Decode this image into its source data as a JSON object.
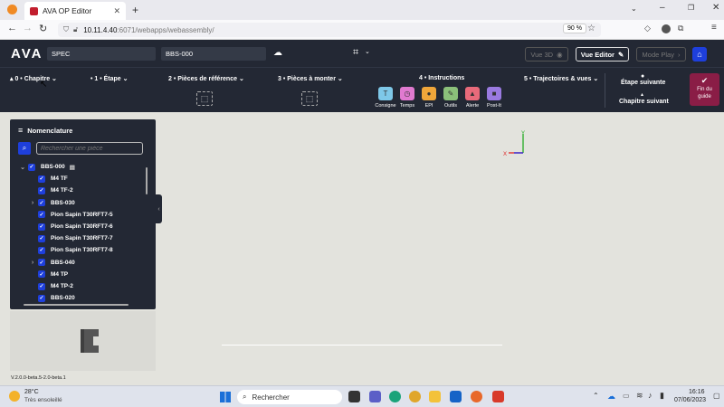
{
  "browser": {
    "tab_title": "AVA OP Editor",
    "url_host": "10.11.4.40",
    "url_rest": ":6071/webapps/webassembly/",
    "zoom": "90 %"
  },
  "header": {
    "logo": "AVA",
    "spec_value": "SPEC",
    "doc_value": "BBS-000",
    "vue3d_label": "Vue 3D",
    "vue_editor_label": "Vue Editor",
    "mode_play_label": "Mode Play"
  },
  "steps": {
    "chapitre": "0 • Chapitre",
    "etape": "1 • Étape",
    "pieces_ref": "2 • Pièces de référence",
    "pieces_monter": "3 • Pièces à monter",
    "instructions": "4 • Instructions",
    "trajectoires": "5 • Trajectoires & vues",
    "etape_suivante": "Étape suivante",
    "chapitre_suivant": "Chapitre suivant",
    "fin_guide": "Fin du guide"
  },
  "instruction_tools": [
    {
      "label": "Consigne",
      "glyph": "T",
      "color": "#7ec8e8"
    },
    {
      "label": "Temps",
      "glyph": "◷",
      "color": "#e07ad0"
    },
    {
      "label": "EPI",
      "glyph": "●",
      "color": "#f0a63a"
    },
    {
      "label": "Outils",
      "glyph": "✎",
      "color": "#8bc07a"
    },
    {
      "label": "Alerte",
      "glyph": "▲",
      "color": "#e86a7a"
    },
    {
      "label": "Post-It",
      "glyph": "■",
      "color": "#9a7ae0"
    }
  ],
  "nomenclature": {
    "title": "Nomenclature",
    "search_placeholder": "Rechercher une pièce",
    "items": [
      {
        "label": "BBS-000",
        "level": 0,
        "expand": "open"
      },
      {
        "label": "M4 TF",
        "level": 1,
        "expand": ""
      },
      {
        "label": "M4 TF-2",
        "level": 1,
        "expand": ""
      },
      {
        "label": "BBS-030",
        "level": 1,
        "expand": "closed"
      },
      {
        "label": "Pion Sapin T30RFT7-5",
        "level": 1,
        "expand": ""
      },
      {
        "label": "Pion Sapin T30RFT7-6",
        "level": 1,
        "expand": ""
      },
      {
        "label": "Pion Sapin T30RFT7-7",
        "level": 1,
        "expand": ""
      },
      {
        "label": "Pion Sapin T30RFT7-8",
        "level": 1,
        "expand": ""
      },
      {
        "label": "BBS-040",
        "level": 1,
        "expand": "closed"
      },
      {
        "label": "M4 TP",
        "level": 1,
        "expand": ""
      },
      {
        "label": "M4 TP-2",
        "level": 1,
        "expand": ""
      },
      {
        "label": "BBS-020",
        "level": 1,
        "expand": ""
      }
    ]
  },
  "version": "V.2.0.0-beta.5-2.0-beta.1",
  "taskbar": {
    "weather_temp": "28°C",
    "weather_desc": "Très ensoleillé",
    "search_label": "Rechercher",
    "time": "16:16",
    "date": "07/06/2023"
  }
}
